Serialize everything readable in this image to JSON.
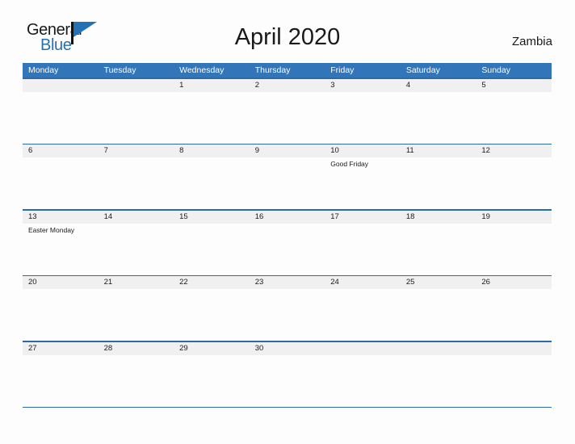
{
  "brand": {
    "name_part1": "General",
    "name_part2": "Blue",
    "flag_icon": "blue-flag-icon",
    "color_primary": "#2471b5",
    "color_text": "#1a1a1a"
  },
  "header": {
    "title": "April 2020",
    "country": "Zambia"
  },
  "theme": {
    "header_row_bg": "#3275b8",
    "week_separator": "#2b6ca8",
    "date_band_bg": "#f0f0f0",
    "page_bg": "#fdfdfd",
    "text": "#1a1a1a",
    "header_row_text": "#ffffff"
  },
  "calendar": {
    "month": "April",
    "year": "2020",
    "weekday_headers": [
      "Monday",
      "Tuesday",
      "Wednesday",
      "Thursday",
      "Friday",
      "Saturday",
      "Sunday"
    ],
    "weeks": [
      {
        "days": [
          {
            "date": "",
            "events": []
          },
          {
            "date": "",
            "events": []
          },
          {
            "date": "1",
            "events": []
          },
          {
            "date": "2",
            "events": []
          },
          {
            "date": "3",
            "events": []
          },
          {
            "date": "4",
            "events": []
          },
          {
            "date": "5",
            "events": []
          }
        ]
      },
      {
        "days": [
          {
            "date": "6",
            "events": []
          },
          {
            "date": "7",
            "events": []
          },
          {
            "date": "8",
            "events": []
          },
          {
            "date": "9",
            "events": []
          },
          {
            "date": "10",
            "events": [
              "Good Friday"
            ]
          },
          {
            "date": "11",
            "events": []
          },
          {
            "date": "12",
            "events": []
          }
        ]
      },
      {
        "days": [
          {
            "date": "13",
            "events": [
              "Easter Monday"
            ]
          },
          {
            "date": "14",
            "events": []
          },
          {
            "date": "15",
            "events": []
          },
          {
            "date": "16",
            "events": []
          },
          {
            "date": "17",
            "events": []
          },
          {
            "date": "18",
            "events": []
          },
          {
            "date": "19",
            "events": []
          }
        ]
      },
      {
        "days": [
          {
            "date": "20",
            "events": []
          },
          {
            "date": "21",
            "events": []
          },
          {
            "date": "22",
            "events": []
          },
          {
            "date": "23",
            "events": []
          },
          {
            "date": "24",
            "events": []
          },
          {
            "date": "25",
            "events": []
          },
          {
            "date": "26",
            "events": []
          }
        ]
      },
      {
        "days": [
          {
            "date": "27",
            "events": []
          },
          {
            "date": "28",
            "events": []
          },
          {
            "date": "29",
            "events": []
          },
          {
            "date": "30",
            "events": []
          },
          {
            "date": "",
            "events": []
          },
          {
            "date": "",
            "events": []
          },
          {
            "date": "",
            "events": []
          }
        ]
      }
    ]
  }
}
